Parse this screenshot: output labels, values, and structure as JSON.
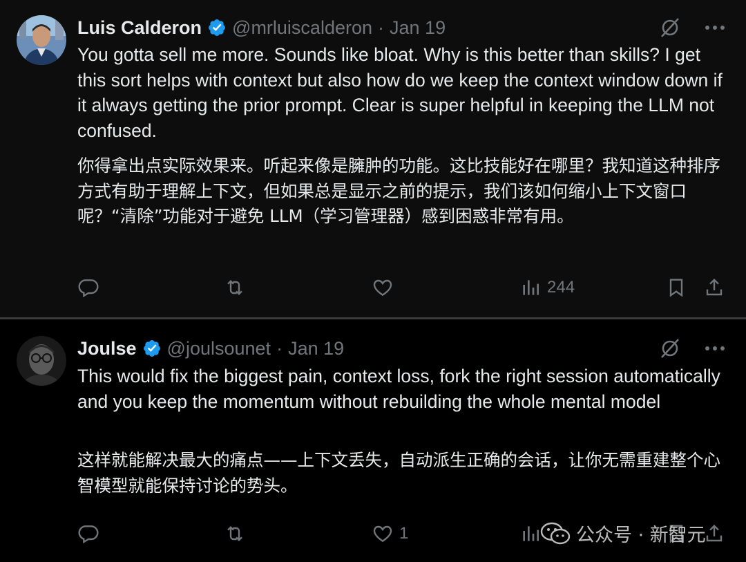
{
  "tweets": [
    {
      "name": "Luis Calderon",
      "handle": "@mrluiscalderon",
      "separator": "·",
      "date": "Jan 19",
      "text_en": "You gotta sell me more. Sounds like bloat. Why is this better than skills? I get this sort helps with context but also how do we keep the context window down if it always getting the prior prompt. Clear is super helpful in keeping the LLM not confused.",
      "text_zh": "你得拿出点实际效果来。听起来像是臃肿的功能。这比技能好在哪里？我知道这种排序方式有助于理解上下文，但如果总是显示之前的提示，我们该如何缩小上下文窗口呢？“清除”功能对于避免 LLM（学习管理器）感到困惑非常有用。",
      "views": "244",
      "likes": ""
    },
    {
      "name": "Joulse",
      "handle": "@joulsounet",
      "separator": "·",
      "date": "Jan 19",
      "text_en": "This would fix the biggest pain, context loss, fork the right session automatically and you keep the momentum without rebuilding the whole mental model",
      "text_zh": "这样就能解决最大的痛点——上下文丢失，自动派生正确的会话，让你无需重建整个心智模型就能保持讨论的势头。",
      "views": "",
      "likes": "1"
    }
  ],
  "icons": {
    "reply": "reply-icon",
    "repost": "repost-icon",
    "like": "heart-icon",
    "views": "views-icon",
    "bookmark": "bookmark-icon",
    "share": "share-icon",
    "grok": "grok-icon",
    "more": "more-icon",
    "verified": "verified-badge-icon"
  },
  "watermark": {
    "text": "公众号 · 新智元"
  },
  "colors": {
    "background": "#000000",
    "text": "#e7e9ea",
    "muted": "#71767b",
    "verified": "#1d9bf0"
  }
}
